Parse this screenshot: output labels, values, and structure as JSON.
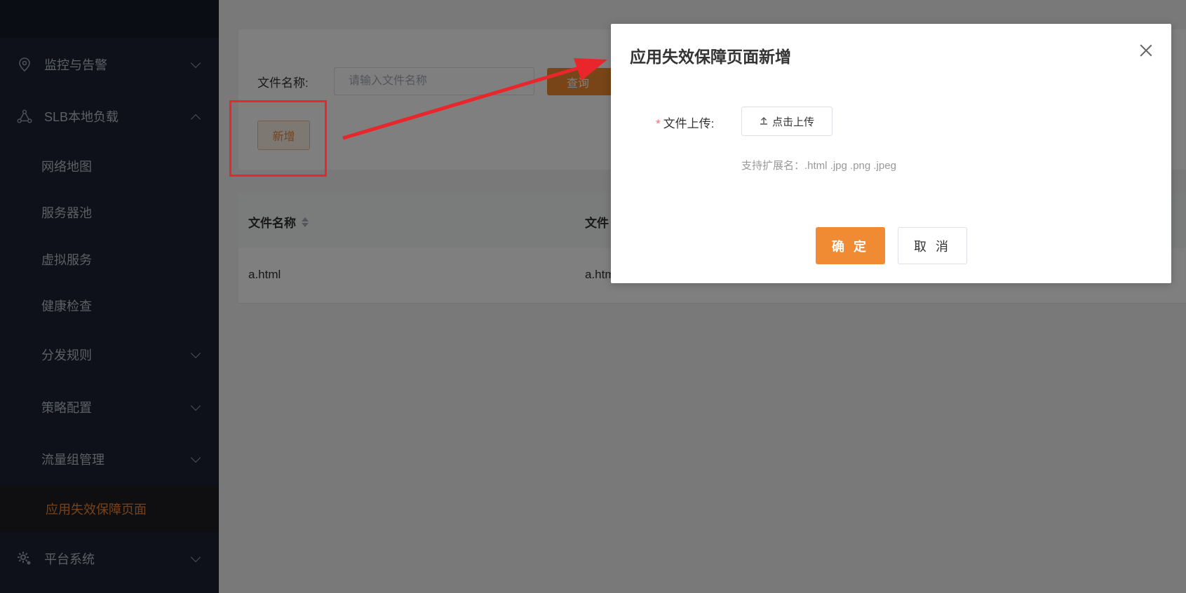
{
  "sidebar": {
    "items": [
      {
        "label": "监控与告警",
        "icon": "location-pin-icon",
        "expanded": false
      },
      {
        "label": "SLB本地负载",
        "icon": "network-nodes-icon",
        "expanded": true
      },
      {
        "label": "网络地图"
      },
      {
        "label": "服务器池"
      },
      {
        "label": "虚拟服务"
      },
      {
        "label": "健康检查"
      },
      {
        "label": "分发规则",
        "expanded": false
      },
      {
        "label": "策略配置",
        "expanded": false
      },
      {
        "label": "流量组管理",
        "expanded": false
      },
      {
        "label": "应用失效保障页面",
        "active": true
      },
      {
        "label": "平台系统",
        "icon": "gear-icon",
        "expanded": false
      }
    ]
  },
  "filter": {
    "label": "文件名称:",
    "placeholder": "请输入文件名称",
    "query_label": "查询",
    "add_label": "新增"
  },
  "table": {
    "columns": [
      "文件名称",
      "文件"
    ],
    "rows": [
      [
        "a.html",
        "a.htm"
      ]
    ]
  },
  "dialog": {
    "title": "应用失效保障页面新增",
    "field_label": "文件上传:",
    "required_mark": "*",
    "upload_label": "点击上传",
    "hint": "支持扩展名：.html .jpg .png .jpeg",
    "confirm_label": "确 定",
    "cancel_label": "取 消"
  },
  "colors": {
    "accent": "#f08a33",
    "annotation": "#e8262b",
    "sidebar_bg": "#1c2333"
  }
}
